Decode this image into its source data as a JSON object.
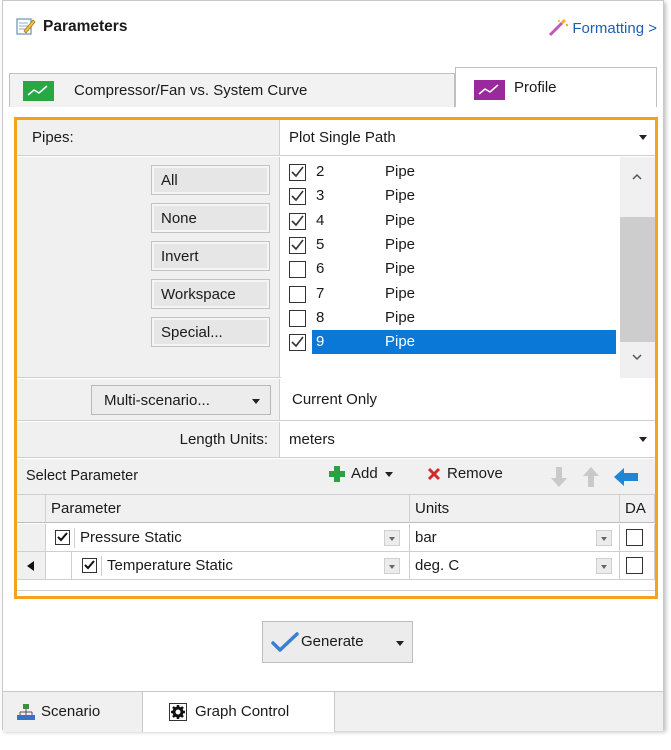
{
  "header": {
    "title": "Parameters",
    "formatting_link": "Formatting >"
  },
  "tabs": [
    {
      "label": "Compressor/Fan vs. System Curve",
      "active": false
    },
    {
      "label": "Profile",
      "active": true
    }
  ],
  "pipes": {
    "label": "Pipes:",
    "mode": "Plot Single Path",
    "buttons": [
      "All",
      "None",
      "Invert",
      "Workspace",
      "Special..."
    ],
    "items": [
      {
        "num": "2",
        "type": "Pipe",
        "checked": true,
        "selected": false
      },
      {
        "num": "3",
        "type": "Pipe",
        "checked": true,
        "selected": false
      },
      {
        "num": "4",
        "type": "Pipe",
        "checked": true,
        "selected": false
      },
      {
        "num": "5",
        "type": "Pipe",
        "checked": true,
        "selected": false
      },
      {
        "num": "6",
        "type": "Pipe",
        "checked": false,
        "selected": false
      },
      {
        "num": "7",
        "type": "Pipe",
        "checked": false,
        "selected": false
      },
      {
        "num": "8",
        "type": "Pipe",
        "checked": false,
        "selected": false
      },
      {
        "num": "9",
        "type": "Pipe",
        "checked": true,
        "selected": true
      }
    ]
  },
  "multi_scenario": {
    "button_label": "Multi-scenario...",
    "value": "Current Only"
  },
  "length_units": {
    "label": "Length Units:",
    "value": "meters"
  },
  "select_parameter": {
    "label": "Select Parameter",
    "add_label": "Add",
    "remove_label": "Remove"
  },
  "param_grid": {
    "headers": {
      "parameter": "Parameter",
      "units": "Units",
      "da": "DA"
    },
    "rows": [
      {
        "name": "Pressure Static",
        "units": "bar",
        "checked": true,
        "da": false
      },
      {
        "name": "Temperature Static",
        "units": "deg. C",
        "checked": true,
        "da": false
      }
    ]
  },
  "generate": {
    "label": "Generate"
  },
  "bottom_tabs": [
    {
      "label": "Scenario",
      "active": false
    },
    {
      "label": "Graph Control",
      "active": true
    }
  ],
  "colors": {
    "frame_accent": "#f2a41c",
    "selection": "#0a78d7",
    "link": "#1e5fb4",
    "add_green": "#2ea043",
    "remove_red": "#d22a2a",
    "arrow_blue": "#1f86d6"
  }
}
